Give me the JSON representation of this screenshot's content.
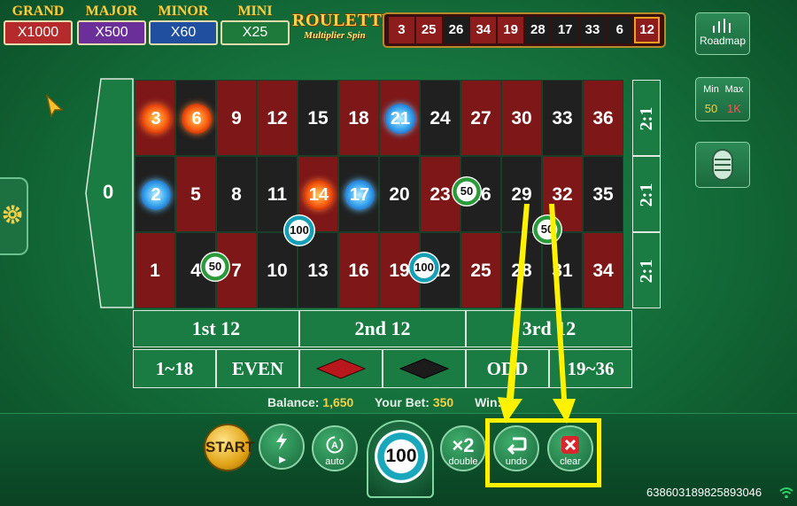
{
  "jackpots": [
    {
      "label": "GRAND",
      "value": "X1000"
    },
    {
      "label": "MAJOR",
      "value": "X500"
    },
    {
      "label": "MINOR",
      "value": "X60"
    },
    {
      "label": "MINI",
      "value": "X25"
    }
  ],
  "logo": {
    "title": "ROULETTE",
    "subtitle": "Multiplier Spin"
  },
  "history": [
    {
      "n": "3",
      "color": "red"
    },
    {
      "n": "25",
      "color": "red"
    },
    {
      "n": "26",
      "color": "black"
    },
    {
      "n": "34",
      "color": "red"
    },
    {
      "n": "19",
      "color": "red"
    },
    {
      "n": "28",
      "color": "black"
    },
    {
      "n": "17",
      "color": "black"
    },
    {
      "n": "33",
      "color": "black"
    },
    {
      "n": "6",
      "color": "black"
    },
    {
      "n": "12",
      "color": "red",
      "latest": true
    }
  ],
  "side": {
    "roadmap_label": "Roadmap",
    "min_label": "Min",
    "max_label": "Max",
    "min_value": "50",
    "max_value": "1K"
  },
  "table": {
    "zero": "0",
    "rows": [
      [
        {
          "n": "3",
          "c": "red",
          "m": "fire"
        },
        {
          "n": "6",
          "c": "black",
          "m": "fire"
        },
        {
          "n": "9",
          "c": "red"
        },
        {
          "n": "12",
          "c": "red"
        },
        {
          "n": "15",
          "c": "black"
        },
        {
          "n": "18",
          "c": "red"
        },
        {
          "n": "21",
          "c": "red",
          "m": "ice"
        },
        {
          "n": "24",
          "c": "black"
        },
        {
          "n": "27",
          "c": "red"
        },
        {
          "n": "30",
          "c": "red"
        },
        {
          "n": "33",
          "c": "black"
        },
        {
          "n": "36",
          "c": "red"
        }
      ],
      [
        {
          "n": "2",
          "c": "black",
          "m": "ice"
        },
        {
          "n": "5",
          "c": "red"
        },
        {
          "n": "8",
          "c": "black"
        },
        {
          "n": "11",
          "c": "black"
        },
        {
          "n": "14",
          "c": "red",
          "m": "fire"
        },
        {
          "n": "17",
          "c": "black",
          "m": "ice"
        },
        {
          "n": "20",
          "c": "black"
        },
        {
          "n": "23",
          "c": "red"
        },
        {
          "n": "26",
          "c": "black"
        },
        {
          "n": "29",
          "c": "black"
        },
        {
          "n": "32",
          "c": "red"
        },
        {
          "n": "35",
          "c": "black"
        }
      ],
      [
        {
          "n": "1",
          "c": "red"
        },
        {
          "n": "4",
          "c": "black"
        },
        {
          "n": "7",
          "c": "red"
        },
        {
          "n": "10",
          "c": "black"
        },
        {
          "n": "13",
          "c": "black"
        },
        {
          "n": "16",
          "c": "red"
        },
        {
          "n": "19",
          "c": "red"
        },
        {
          "n": "22",
          "c": "black"
        },
        {
          "n": "25",
          "c": "red"
        },
        {
          "n": "28",
          "c": "black"
        },
        {
          "n": "31",
          "c": "black"
        },
        {
          "n": "34",
          "c": "red"
        }
      ]
    ],
    "column_bets": [
      "2:1",
      "2:1",
      "2:1"
    ],
    "dozens": [
      "1st 12",
      "2nd 12",
      "3rd 12"
    ],
    "outside": [
      "1~18",
      "EVEN",
      "",
      "",
      "ODD",
      "19~36"
    ],
    "red_diamond_color": "#b8171c",
    "black_diamond_color": "#1b1b1b"
  },
  "placed_chips": [
    {
      "value": "50"
    },
    {
      "value": "100"
    },
    {
      "value": "50"
    },
    {
      "value": "100"
    },
    {
      "value": "50"
    }
  ],
  "status": {
    "balance_label": "Balance:",
    "balance_value": "1,650",
    "bet_label": "Your Bet:",
    "bet_value": "350",
    "win_label": "Win:",
    "win_value": "0"
  },
  "controls": {
    "start_label": "START",
    "auto_label": "auto",
    "chip_value": "100",
    "double_text": "×2",
    "double_label": "double",
    "undo_label": "undo",
    "clear_label": "clear"
  },
  "session_id": "638603189825893046",
  "highlight_color": "#fff200"
}
